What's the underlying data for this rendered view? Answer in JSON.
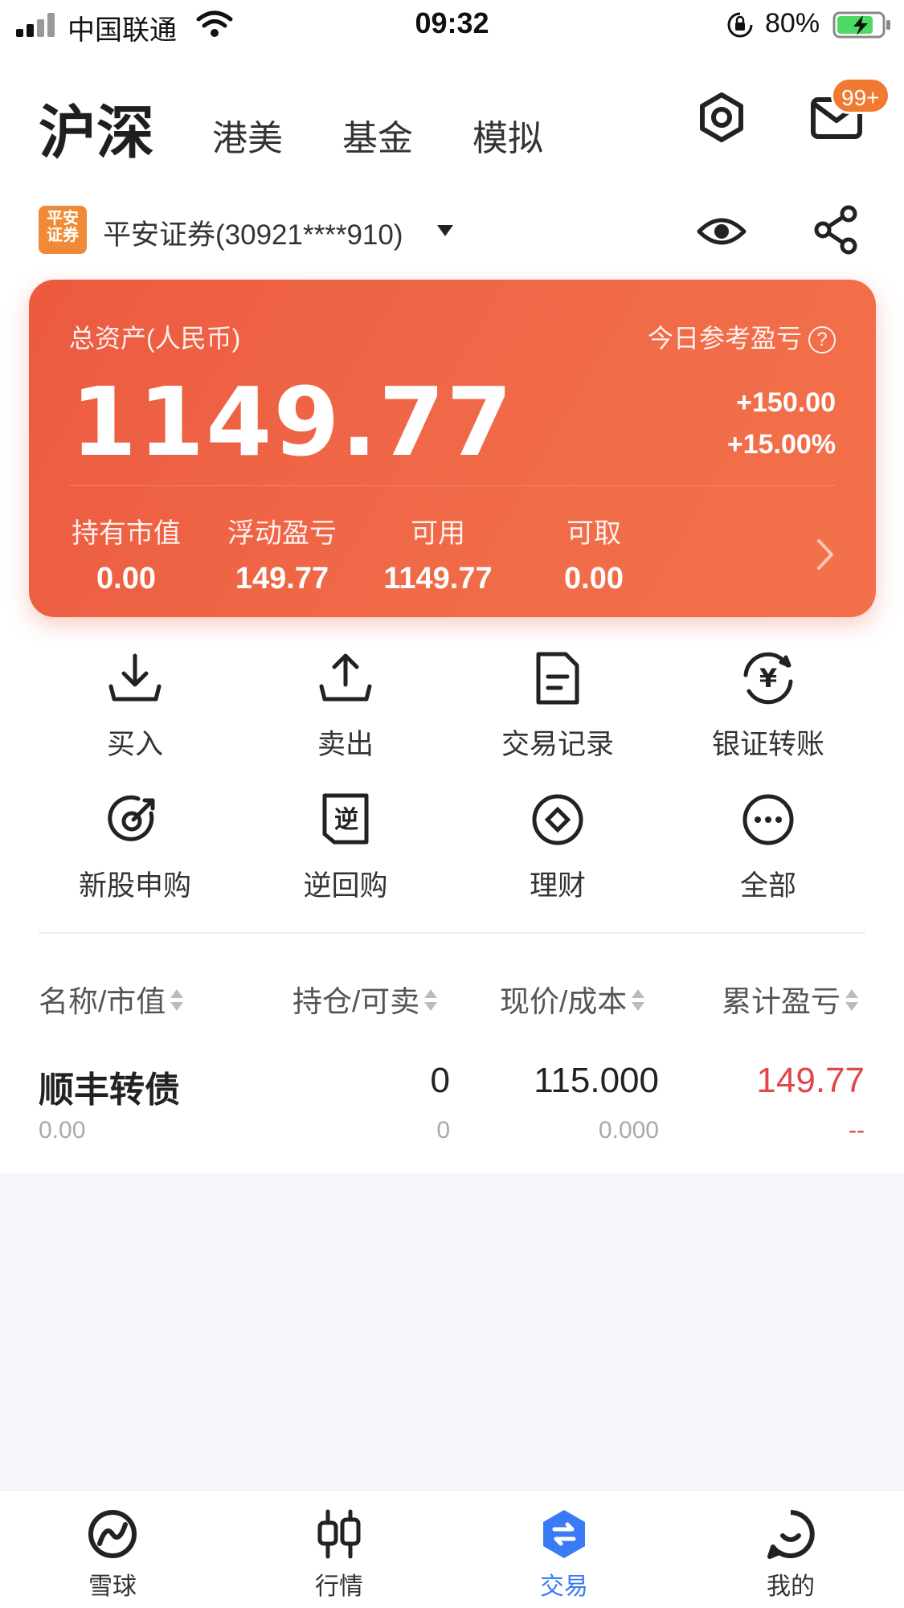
{
  "status_bar": {
    "carrier": "中国联通",
    "time": "09:32",
    "battery": "80%"
  },
  "header": {
    "tabs": [
      {
        "label": "沪深",
        "active": true
      },
      {
        "label": "港美"
      },
      {
        "label": "基金"
      },
      {
        "label": "模拟"
      }
    ],
    "mail_badge": "99+",
    "icons": [
      "settings-icon",
      "mail-icon"
    ]
  },
  "account": {
    "broker_logo_text": "平安\n证券",
    "name": "平安证券(30921****910)",
    "icons": [
      "eye-icon",
      "share-icon"
    ]
  },
  "asset_card": {
    "total_label": "总资产(人民币)",
    "total_value": "1149.77",
    "today_label": "今日参考盈亏",
    "today_amount": "+150.00",
    "today_pct": "+15.00%",
    "stats": [
      {
        "label": "持有市值",
        "value": "0.00"
      },
      {
        "label": "浮动盈亏",
        "value": "149.77"
      },
      {
        "label": "可用",
        "value": "1149.77"
      },
      {
        "label": "可取",
        "value": "0.00"
      }
    ],
    "background": "#ee6244"
  },
  "actions": [
    {
      "label": "买入",
      "icon": "buy-icon"
    },
    {
      "label": "卖出",
      "icon": "sell-icon"
    },
    {
      "label": "交易记录",
      "icon": "record-icon"
    },
    {
      "label": "银证转账",
      "icon": "transfer-icon"
    },
    {
      "label": "新股申购",
      "icon": "ipo-icon"
    },
    {
      "label": "逆回购",
      "icon": "reverse-repo-icon",
      "glyph": "逆"
    },
    {
      "label": "理财",
      "icon": "wealth-icon"
    },
    {
      "label": "全部",
      "icon": "more-icon"
    }
  ],
  "holdings": {
    "columns": [
      "名称/市值",
      "持仓/可卖",
      "现价/成本",
      "累计盈亏"
    ],
    "rows": [
      {
        "name": "顺丰转债",
        "market_value": "0.00",
        "position": "0",
        "sellable": "0",
        "price": "115.000",
        "cost": "0.000",
        "pnl": "149.77",
        "pnl_pct": "--"
      }
    ],
    "pnl_color": "#e0474c"
  },
  "bottom_nav": [
    {
      "label": "雪球",
      "icon": "snowball-icon"
    },
    {
      "label": "行情",
      "icon": "market-icon"
    },
    {
      "label": "交易",
      "icon": "trade-icon",
      "active": true
    },
    {
      "label": "我的",
      "icon": "profile-icon"
    }
  ],
  "accent": "#3a7bf5"
}
